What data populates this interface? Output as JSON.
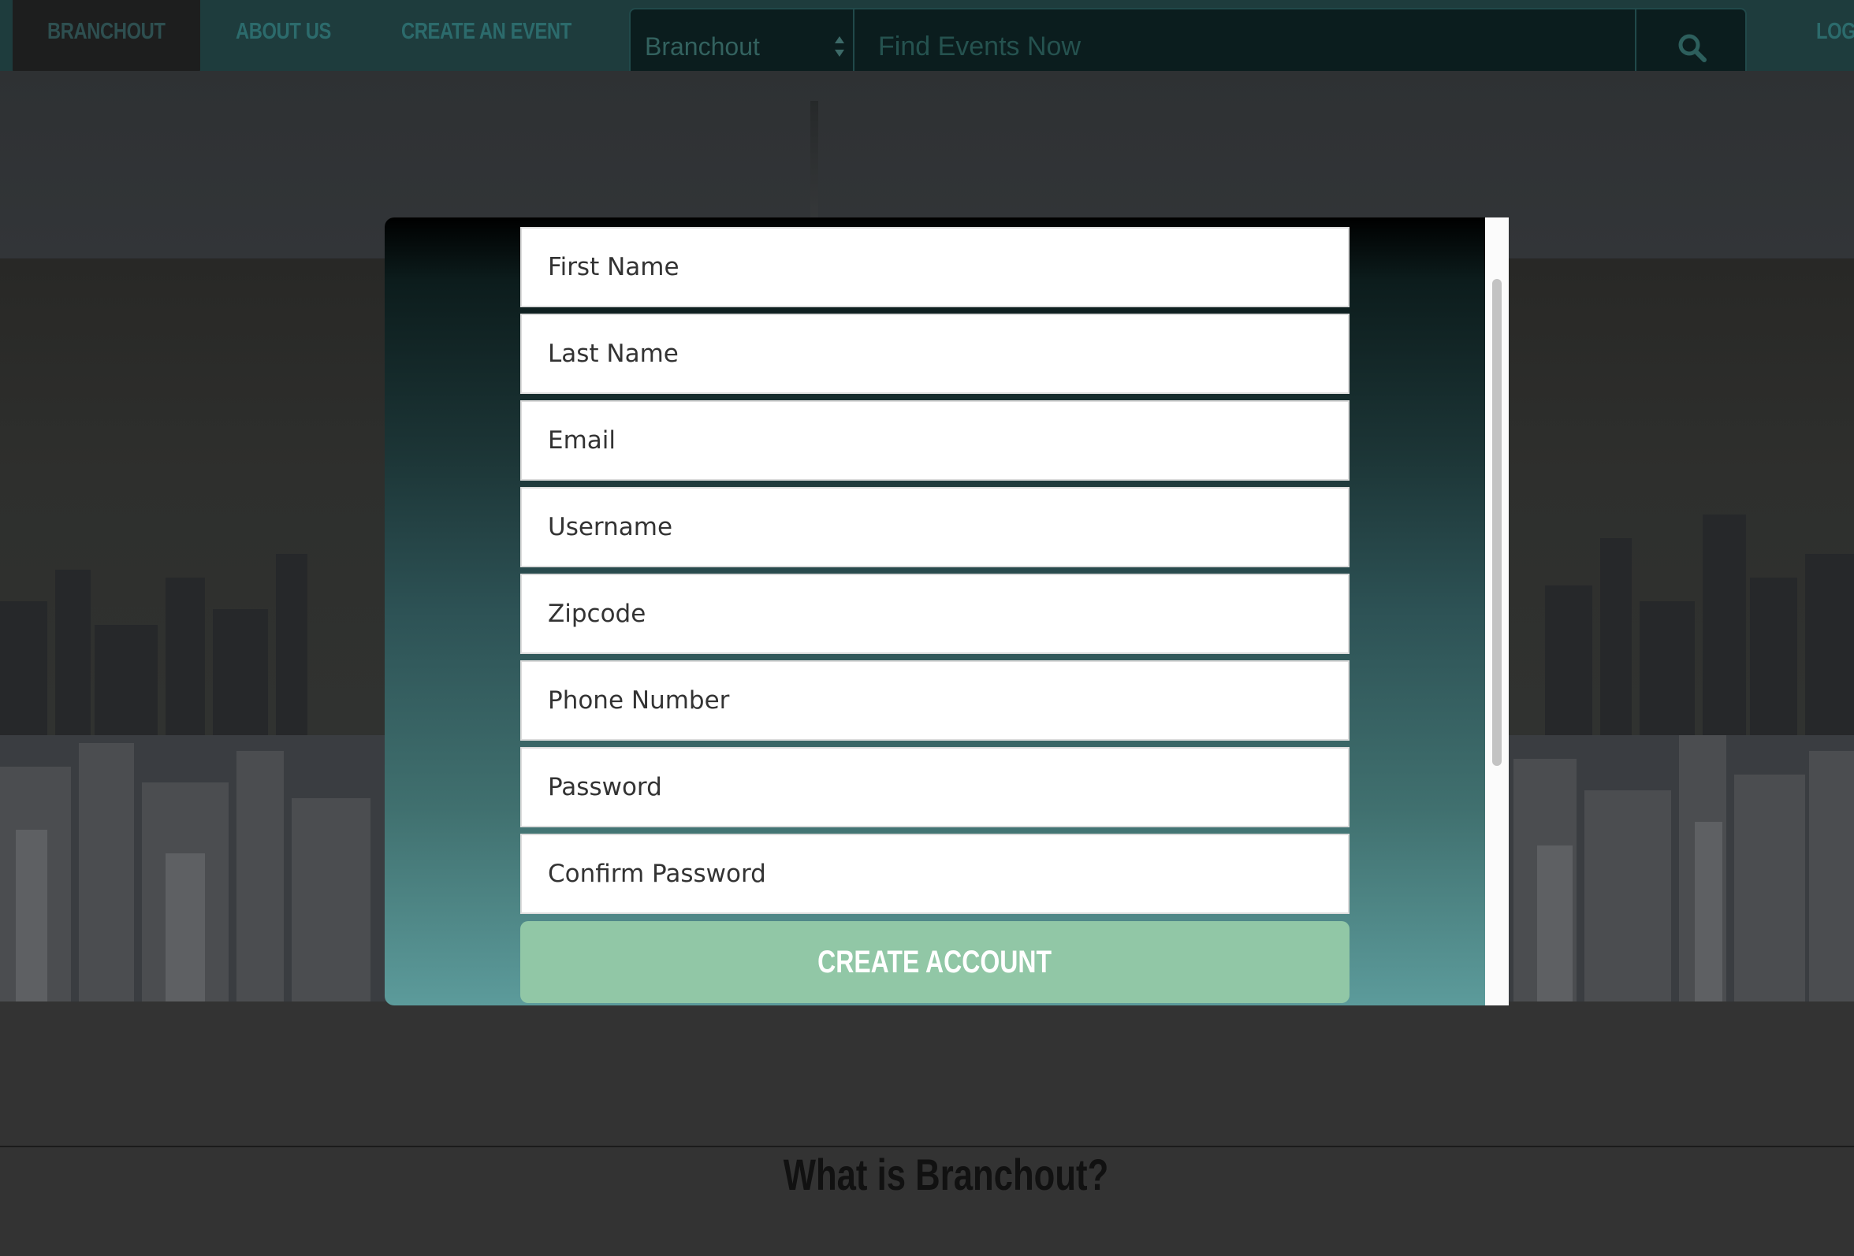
{
  "nav": {
    "home_label": "BRANCHOUT",
    "about_label": "ABOUT US",
    "create_event_label": "CREATE AN EVENT",
    "login_label": "LOG"
  },
  "search": {
    "select_value": "Branchout",
    "placeholder": "Find Events Now"
  },
  "page": {
    "section_title": "What is Branchout?"
  },
  "signup_modal": {
    "fields": {
      "first_name": "First Name",
      "last_name": "Last Name",
      "email": "Email",
      "username": "Username",
      "zipcode": "Zipcode",
      "phone": "Phone Number",
      "password": "Password",
      "confirm_password": "Confirm Password"
    },
    "submit_label": "CREATE ACCOUNT"
  },
  "colors": {
    "navbar": "#1e3c3d",
    "button": "#91c7a6",
    "modal_gradient_top": "#000000",
    "modal_gradient_bottom": "#5c9b9b"
  }
}
